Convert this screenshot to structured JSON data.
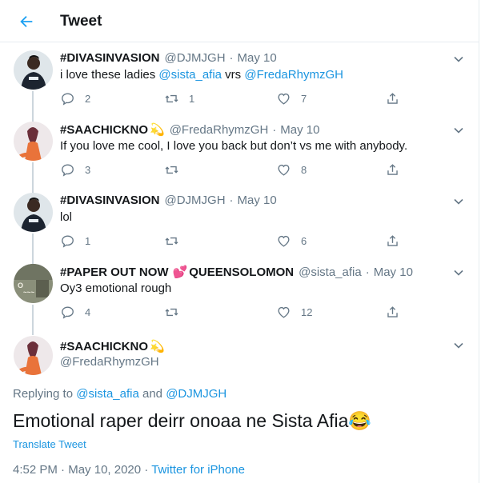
{
  "header": {
    "title": "Tweet"
  },
  "replies": [
    {
      "name": "#DIVASINVASION",
      "handle": "@DJMJGH",
      "separator": "·",
      "date": "May 10",
      "text_plain": "i love these ladies ",
      "mention1": "@sista_afia",
      "text_mid": " vrs ",
      "mention2": "@FredaRhymzGH",
      "replies": "2",
      "retweets": "1",
      "likes": "7"
    },
    {
      "name": "#SAACHICKNO",
      "emoji": "💫",
      "handle": "@FredaRhymzGH",
      "separator": "·",
      "date": "May 10",
      "text": "If you love me cool, I love you back but don’t vs me with anybody.",
      "replies": "3",
      "retweets": "",
      "likes": "8"
    },
    {
      "name": "#DIVASINVASION",
      "handle": "@DJMJGH",
      "separator": "·",
      "date": "May 10",
      "text": "lol",
      "replies": "1",
      "retweets": "",
      "likes": "6"
    },
    {
      "name": "#PAPER OUT NOW",
      "heart_emoji": "💕",
      "name2": "QUEENSOLOMON",
      "handle": "@sista_afia",
      "separator": "·",
      "date": "May 10",
      "text": "Oy3 emotional rough",
      "replies": "4",
      "retweets": "",
      "likes": "12"
    }
  ],
  "main_tweet": {
    "name": "#SAACHICKNO",
    "emoji": "💫",
    "handle": "@FredaRhymzGH",
    "replying_prefix": "Replying to ",
    "replying_to1": "@sista_afia",
    "replying_and": " and ",
    "replying_to2": "@DJMJGH",
    "text": "Emotional raper deirr onoaa ne Sista Afia",
    "text_emoji": "😂",
    "translate": "Translate Tweet",
    "time": "4:52 PM",
    "separator": "·",
    "date": "May 10, 2020",
    "separator2": "·",
    "source": "Twitter for iPhone"
  },
  "colors": {
    "accent": "#1b95e0",
    "muted": "#657786",
    "text": "#14171a",
    "border": "#e6ecf0"
  }
}
